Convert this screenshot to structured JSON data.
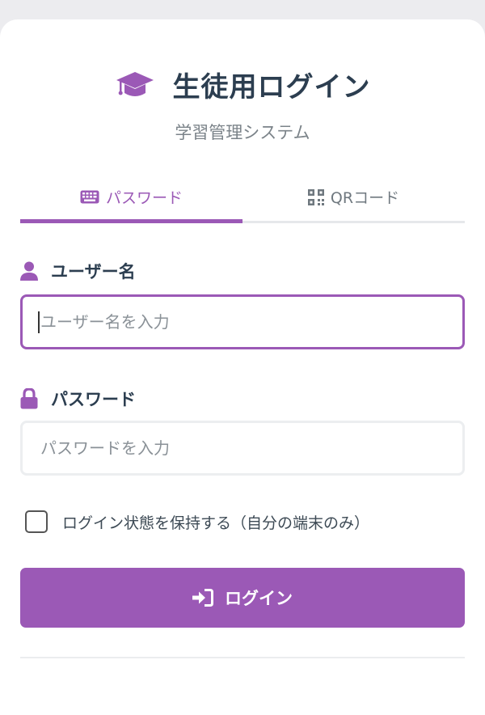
{
  "header": {
    "title": "生徒用ログイン",
    "subtitle": "学習管理システム",
    "icon": "graduation-cap-icon"
  },
  "tabs": [
    {
      "label": "パスワード",
      "icon": "keyboard-icon",
      "active": true
    },
    {
      "label": "QRコード",
      "icon": "qrcode-icon",
      "active": false
    }
  ],
  "username": {
    "label": "ユーザー名",
    "icon": "user-icon",
    "placeholder": "ユーザー名を入力",
    "value": ""
  },
  "password": {
    "label": "パスワード",
    "icon": "lock-icon",
    "placeholder": "パスワードを入力",
    "value": ""
  },
  "remember": {
    "label": "ログイン状態を保持する（自分の端末のみ）",
    "checked": false
  },
  "login_button": {
    "label": "ログイン",
    "icon": "sign-in-icon"
  },
  "colors": {
    "accent": "#9b59b6",
    "text_dark": "#2c3e50",
    "text_muted": "#7b8389"
  }
}
